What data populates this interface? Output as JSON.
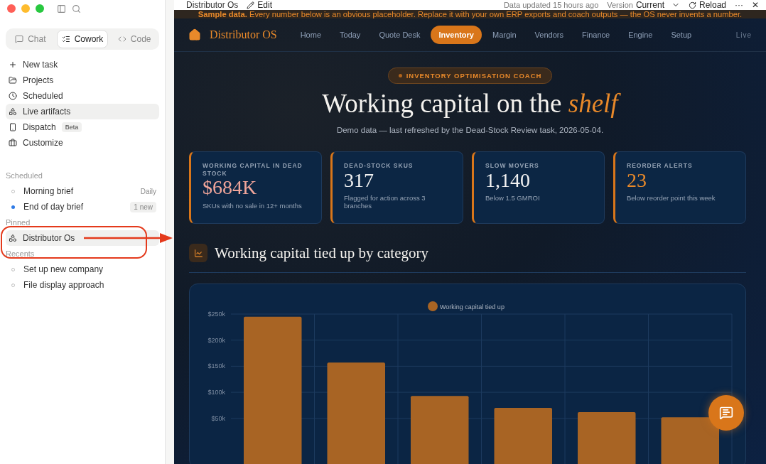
{
  "sidebar": {
    "tabs": [
      {
        "label": "Chat",
        "selected": false
      },
      {
        "label": "Cowork",
        "selected": true
      },
      {
        "label": "Code",
        "selected": false
      }
    ],
    "nav": [
      {
        "label": "New task",
        "kind": "plus",
        "selected": false
      },
      {
        "label": "Projects",
        "kind": "folder",
        "selected": false
      },
      {
        "label": "Scheduled",
        "kind": "clock",
        "selected": false
      },
      {
        "label": "Live artifacts",
        "kind": "artifact",
        "selected": true
      },
      {
        "label": "Dispatch",
        "kind": "phone",
        "selected": false,
        "badge": "Beta"
      },
      {
        "label": "Customize",
        "kind": "briefcase",
        "selected": false
      }
    ],
    "sections": [
      {
        "title": "Scheduled",
        "items": [
          {
            "label": "Morning brief",
            "kind": "dot",
            "unread": false,
            "meta": "Daily",
            "meta_boxed": false
          },
          {
            "label": "End of day brief",
            "kind": "dot",
            "unread": true,
            "meta": "1 new",
            "meta_boxed": true
          }
        ]
      },
      {
        "title": "Pinned",
        "items": [
          {
            "label": "Distributor Os",
            "kind": "artifact",
            "highlighted": true
          }
        ]
      },
      {
        "title": "Recents",
        "items": [
          {
            "label": "Set up new company",
            "kind": "dot",
            "unread": false
          },
          {
            "label": "File display approach",
            "kind": "dot",
            "unread": false
          }
        ]
      }
    ]
  },
  "topbar": {
    "title": "Distributor Os",
    "edit": "Edit",
    "updated": "Data updated 15 hours ago",
    "version_label": "Version",
    "version": "Current",
    "reload": "Reload",
    "more": "···",
    "close": "✕"
  },
  "banner": {
    "text": "**Sample data.** Every number below is an obvious placeholder. Replace it with your own ERP exports and coach outputs — the OS never invents a number."
  },
  "app": {
    "brand": "Distributor OS",
    "nav": [
      {
        "label": "Home",
        "selected": false
      },
      {
        "label": "Today",
        "selected": false
      },
      {
        "label": "Quote Desk",
        "selected": false
      },
      {
        "label": "Inventory",
        "selected": true
      },
      {
        "label": "Margin",
        "selected": false
      },
      {
        "label": "Vendors",
        "selected": false
      },
      {
        "label": "Finance",
        "selected": false
      },
      {
        "label": "Engine",
        "selected": false
      },
      {
        "label": "Setup",
        "selected": false
      }
    ],
    "status": "Live",
    "pill": "INVENTORY OPTIMISATION COACH",
    "headline": "Working capital on the",
    "headline_accent": "shelf",
    "subtitle": "Demo data — last refreshed by the Dead-Stock Review task, 2026-05-04.",
    "cards": [
      {
        "label": "WORKING CAPITAL IN DEAD STOCK",
        "value": "$684K",
        "note": "SKUs with no sale in 12+ months",
        "color": "#f0a59a"
      },
      {
        "label": "DEAD-STOCK SKUS",
        "value": "317",
        "note": "Flagged for action across 3 branches",
        "color": "#f2f2f2"
      },
      {
        "label": "SLOW MOVERS",
        "value": "1,140",
        "note": "Below 1.5 GMROI",
        "color": "#f2f2f2"
      },
      {
        "label": "REORDER ALERTS",
        "value": "23",
        "note": "Below reorder point this week",
        "color": "#e8892a"
      }
    ],
    "section_title": "Working capital tied up by category",
    "chart": {
      "chart_data": {
        "type": "bar",
        "grid": true,
        "ylim": [
          0,
          250
        ],
        "yticks": [
          {
            "value": 50,
            "label": "$50k"
          },
          {
            "value": 100,
            "label": "$100k"
          },
          {
            "value": 150,
            "label": "$150k"
          },
          {
            "value": 200,
            "label": "$200k"
          },
          {
            "value": 250,
            "label": "$250k"
          }
        ],
        "series": [
          {
            "name": "Working capital tied up",
            "color": "#a86424",
            "values": [
              245,
              157,
              93,
              70,
              62,
              52
            ]
          }
        ]
      }
    }
  }
}
